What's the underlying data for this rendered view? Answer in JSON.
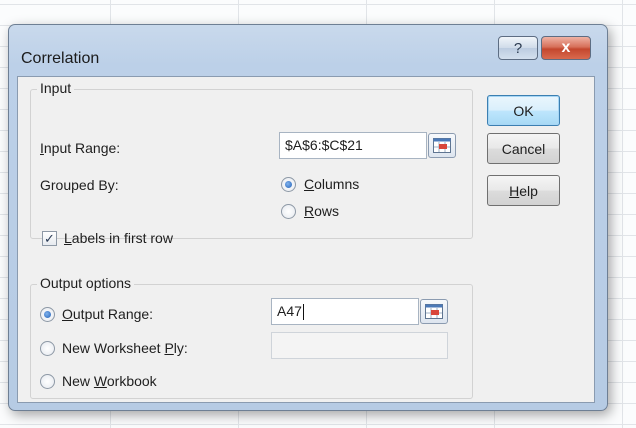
{
  "dialog": {
    "title": "Correlation",
    "help_title_button": "?",
    "close_title_button": "x"
  },
  "input_group": {
    "label": "Input",
    "input_range_label": "Input Range:",
    "input_range_value": "$A$6:$C$21",
    "grouped_by_label": "Grouped By:",
    "columns_label": "Columns",
    "columns_selected": true,
    "rows_label": "Rows",
    "rows_selected": false,
    "labels_first_row_label": "Labels in first row",
    "labels_first_row_checked": true
  },
  "output_group": {
    "label": "Output options",
    "output_range_label": "Output Range:",
    "output_range_selected": true,
    "output_range_value": "A47",
    "new_worksheet_label": "New Worksheet Ply:",
    "new_worksheet_selected": false,
    "new_worksheet_value": "",
    "new_workbook_label": "New Workbook",
    "new_workbook_selected": false
  },
  "buttons": {
    "ok": "OK",
    "cancel": "Cancel",
    "help": "Help"
  },
  "icons": {
    "range_picker": "range-select-icon",
    "help": "question-mark-icon",
    "close": "close-icon"
  }
}
